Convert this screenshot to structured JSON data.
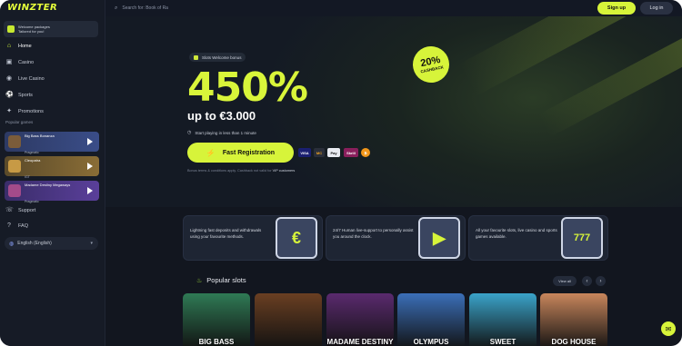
{
  "brand": {
    "logo": "WINZTER"
  },
  "topbar": {
    "search_placeholder": "Search for: Book of Ra",
    "signup": "Sign up",
    "login": "Log in"
  },
  "sidebar": {
    "promo": {
      "line1": "Welcome packages",
      "line2": "Tailored for you!"
    },
    "nav": [
      {
        "label": "Home",
        "icon": "home-icon"
      },
      {
        "label": "Casino",
        "icon": "casino-icon"
      },
      {
        "label": "Live Casino",
        "icon": "live-casino-icon"
      },
      {
        "label": "Sports",
        "icon": "sports-icon"
      },
      {
        "label": "Promotions",
        "icon": "promotions-icon"
      }
    ],
    "section_label": "Popular games",
    "games": [
      {
        "name": "Big Bass Bonanza",
        "provider": "Pragmatic"
      },
      {
        "name": "Cleopatra",
        "provider": "IGT"
      },
      {
        "name": "Madame Destiny Megaways",
        "provider": "Pragmatic"
      }
    ],
    "bottom_nav": [
      {
        "label": "Support",
        "icon": "support-icon"
      },
      {
        "label": "FAQ",
        "icon": "faq-icon"
      }
    ],
    "language": "English (English)"
  },
  "hero": {
    "chip": "Slots Welcome bonus",
    "amount": "450%",
    "upto": "up to €3.000",
    "note": "Start playing in less than 1 minute",
    "cta": "Fast Registration",
    "payments": [
      "VISA",
      "MC",
      "Pay",
      "Skrill",
      "₿"
    ],
    "terms_prefix": "Bonus terms & conditions apply. Cashback not valid for ",
    "terms_highlight": "VIP customers",
    "badge_percent": "20%",
    "badge_label": "CASHBACK"
  },
  "features": [
    {
      "text": "Lightning fast deposits and withdrawals using your favourite methods.",
      "art": "€"
    },
    {
      "text": "24/7 Human live-support to personally assist you around the clock.",
      "art": "▶"
    },
    {
      "text": "All your favourite slots, live casino and sports games available.",
      "art": "777"
    }
  ],
  "popular": {
    "title": "Popular slots",
    "view_all": "View all",
    "slots": [
      {
        "name": "BIG BASS",
        "color": "#2f7a55"
      },
      {
        "name": "",
        "color": "#6a3f22"
      },
      {
        "name": "MADAME DESTINY",
        "color": "#5a2a6e"
      },
      {
        "name": "OLYMPUS",
        "color": "#3b6fb8"
      },
      {
        "name": "SWEET",
        "color": "#3aa3c9"
      },
      {
        "name": "DOG HOUSE",
        "color": "#c8865c"
      }
    ]
  }
}
